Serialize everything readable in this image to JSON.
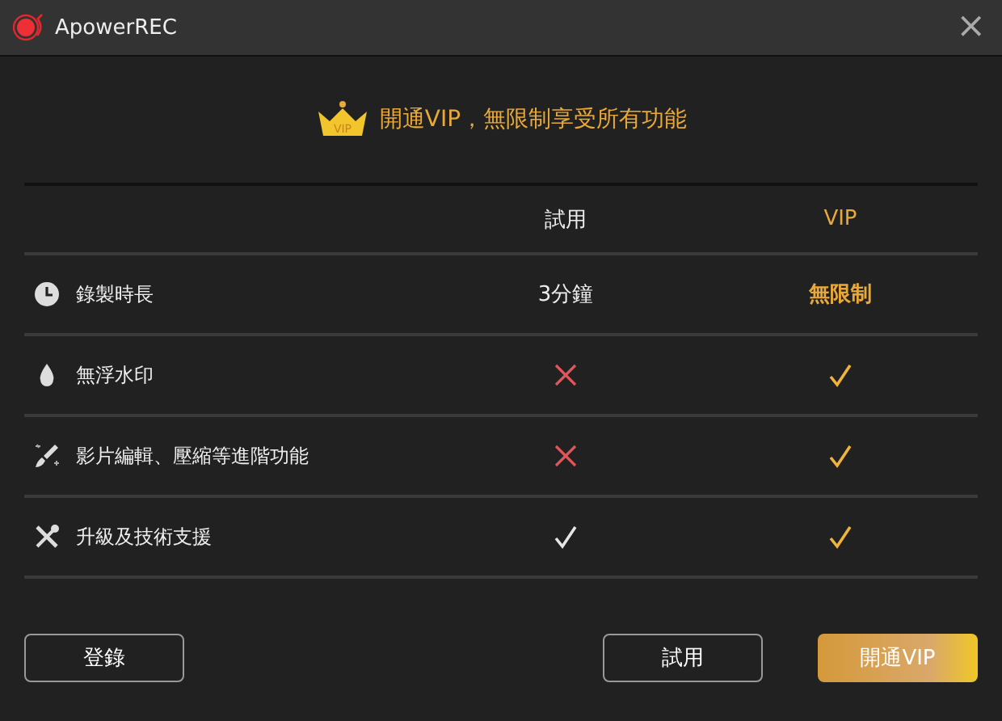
{
  "window": {
    "title": "ApowerREC",
    "close": "×"
  },
  "headline": "開通VIP，無限制享受所有功能",
  "crown_badge": "VIP",
  "table": {
    "columns": [
      "試用",
      "VIP"
    ],
    "rows": [
      {
        "feature": "錄製時長",
        "trial": {
          "kind": "text",
          "text": "3分鐘"
        },
        "vip": {
          "kind": "text",
          "text": "無限制"
        }
      },
      {
        "feature": "無浮水印",
        "trial": {
          "kind": "cross"
        },
        "vip": {
          "kind": "check"
        }
      },
      {
        "feature": "影片編輯、壓縮等進階功能",
        "trial": {
          "kind": "cross"
        },
        "vip": {
          "kind": "check"
        }
      },
      {
        "feature": "升級及技術支援",
        "trial": {
          "kind": "check"
        },
        "vip": {
          "kind": "check"
        }
      }
    ]
  },
  "buttons": {
    "login": "登錄",
    "trial": "試用",
    "upgrade": "開通VIP"
  }
}
